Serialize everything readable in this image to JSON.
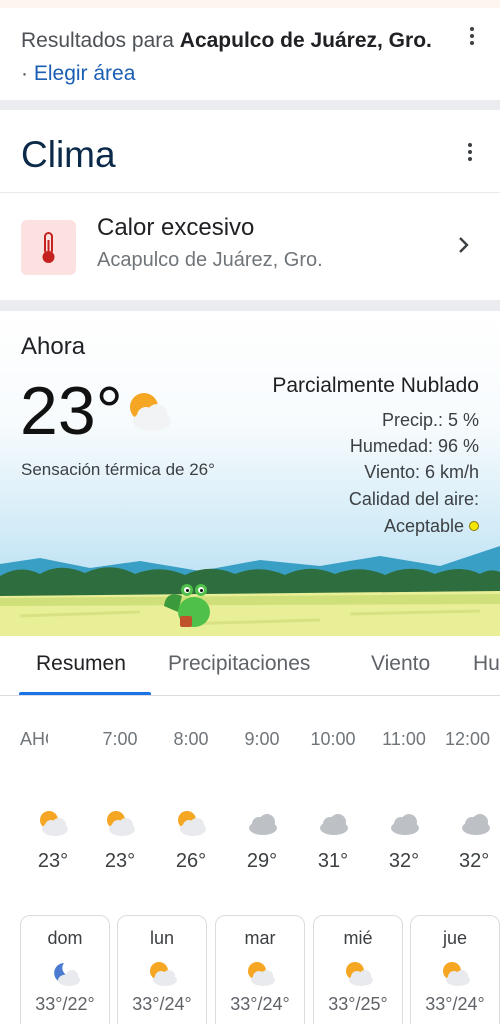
{
  "header": {
    "results_prefix": "Resultados para",
    "location": "Acapulco de Juárez, Gro.",
    "separator": "·",
    "change_area": "Elegir área"
  },
  "weather": {
    "title": "Clima",
    "alert": {
      "title": "Calor excesivo",
      "subtitle": "Acapulco de Juárez, Gro."
    },
    "now": {
      "label": "Ahora",
      "temperature": "23°",
      "feels_like": "Sensación térmica de 26°",
      "condition": "Parcialmente Nublado",
      "precip": "Precip.: 5 %",
      "humidity": "Humedad: 96 %",
      "wind": "Viento: 6 km/h",
      "air_quality_label": "Calidad del aire:",
      "air_quality_value": "Aceptable",
      "air_quality_color": "#f7e600"
    },
    "tabs": [
      "Resumen",
      "Precipitaciones",
      "Viento",
      "Hu"
    ],
    "hourly": [
      {
        "time": "AHORA",
        "temp": "23°",
        "icon": "partly-cloudy-icon"
      },
      {
        "time": "7:00",
        "temp": "23°",
        "icon": "partly-cloudy-icon"
      },
      {
        "time": "8:00",
        "temp": "26°",
        "icon": "partly-cloudy-icon"
      },
      {
        "time": "9:00",
        "temp": "29°",
        "icon": "cloudy-icon"
      },
      {
        "time": "10:00",
        "temp": "31°",
        "icon": "cloudy-icon"
      },
      {
        "time": "11:00",
        "temp": "32°",
        "icon": "cloudy-icon"
      },
      {
        "time": "12:00",
        "temp": "32°",
        "icon": "cloudy-icon"
      }
    ],
    "daily": [
      {
        "day": "dom",
        "temps": "33°/22°",
        "icon": "night-partly-cloudy-icon"
      },
      {
        "day": "lun",
        "temps": "33°/24°",
        "icon": "partly-cloudy-icon"
      },
      {
        "day": "mar",
        "temps": "33°/24°",
        "icon": "partly-cloudy-icon"
      },
      {
        "day": "mié",
        "temps": "33°/25°",
        "icon": "partly-cloudy-icon"
      },
      {
        "day": "jue",
        "temps": "33°/24°",
        "icon": "partly-cloudy-icon"
      }
    ]
  },
  "colors": {
    "accent": "#1a73e8",
    "link": "#1a5fb4",
    "alert_bg": "#fbe2e0",
    "alert_icon": "#c5221f"
  }
}
